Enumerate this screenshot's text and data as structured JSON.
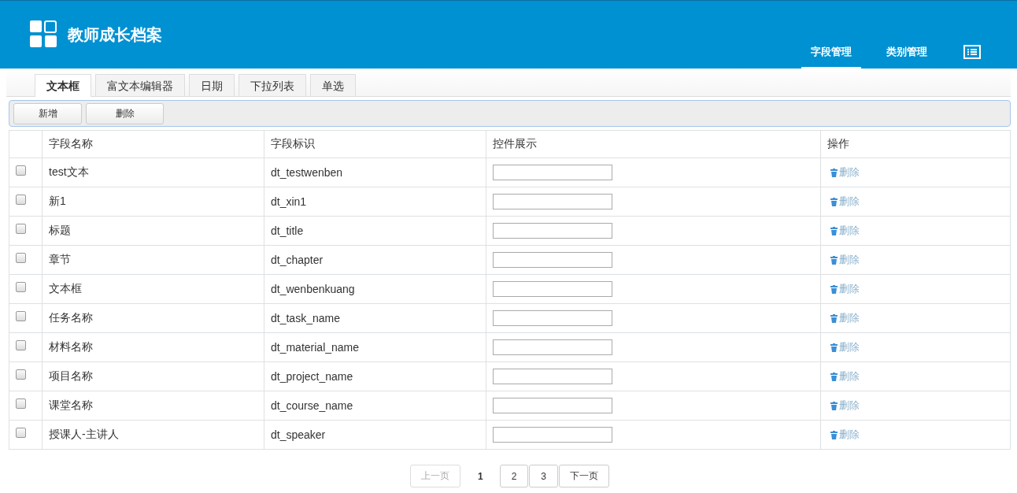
{
  "header": {
    "title": "教师成长档案",
    "nav": [
      {
        "label": "字段管理",
        "selected": true
      },
      {
        "label": "类别管理",
        "selected": false
      }
    ]
  },
  "tabs": [
    {
      "label": "文本框",
      "selected": true
    },
    {
      "label": "富文本编辑器",
      "selected": false
    },
    {
      "label": "日期",
      "selected": false
    },
    {
      "label": "下拉列表",
      "selected": false
    },
    {
      "label": "单选",
      "selected": false
    }
  ],
  "toolbar": [
    "新增",
    "删除"
  ],
  "table": {
    "columns": [
      "字段名称",
      "字段标识",
      "控件展示",
      "操作"
    ],
    "rows": [
      {
        "checked": false,
        "name": "test文本",
        "field_id": "dt_testwenben",
        "action": "删除"
      },
      {
        "checked": false,
        "name": "新1",
        "field_id": "dt_xin1",
        "action": "删除"
      },
      {
        "checked": false,
        "name": "标题",
        "field_id": "dt_title",
        "action": "删除"
      },
      {
        "checked": false,
        "name": "章节",
        "field_id": "dt_chapter",
        "action": "删除"
      },
      {
        "checked": false,
        "name": "文本框",
        "field_id": "dt_wenbenkuang",
        "action": "删除"
      },
      {
        "checked": false,
        "name": "任务名称",
        "field_id": "dt_task_name",
        "action": "删除"
      },
      {
        "checked": false,
        "name": "材料名称",
        "field_id": "dt_material_name",
        "action": "删除"
      },
      {
        "checked": false,
        "name": "项目名称",
        "field_id": "dt_project_name",
        "action": "删除"
      },
      {
        "checked": false,
        "name": "课堂名称",
        "field_id": "dt_course_name",
        "action": "删除"
      },
      {
        "checked": false,
        "name": "授课人-主讲人",
        "field_id": "dt_speaker",
        "action": "删除"
      }
    ]
  },
  "pagination": {
    "prev": {
      "label": "上一页",
      "disabled": true
    },
    "pages": [
      {
        "label": "1",
        "selected": true
      },
      {
        "label": "2",
        "selected": false
      },
      {
        "label": "3",
        "selected": false
      }
    ],
    "next": {
      "label": "下一页",
      "disabled": false
    }
  }
}
